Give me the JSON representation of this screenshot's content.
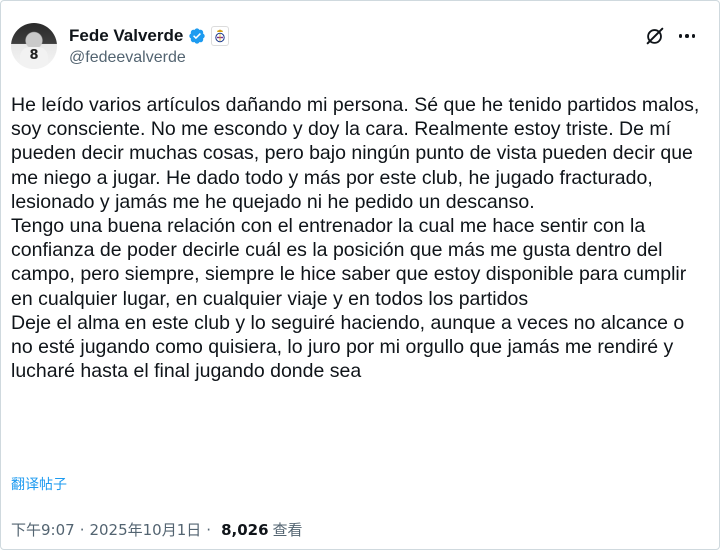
{
  "user": {
    "display_name": "Fede Valverde",
    "handle": "@fedeevalverde",
    "avatar_number": "8"
  },
  "icons": {
    "verified": "verified-badge-icon",
    "affiliate": "real-madrid-crest-icon",
    "grok": "grok-icon",
    "more": "more-icon"
  },
  "colors": {
    "accent": "#1d9bf0",
    "text": "#0f1419",
    "muted": "#536471"
  },
  "tweet": {
    "paragraphs": [
      "He leído varios artículos dañando mi persona. Sé que he tenido partidos malos, soy consciente. No me escondo y doy la cara. Realmente estoy triste. De mí pueden decir muchas cosas, pero bajo ningún punto de vista pueden decir que me niego a jugar. He dado todo y más por este club, he jugado fracturado, lesionado y jamás me he quejado ni he pedido un descanso.",
      "Tengo una buena relación con el entrenador la cual me hace sentir con la confianza de poder decirle cuál es la posición que más me gusta dentro del campo, pero siempre, siempre le hice saber que estoy disponible para cumplir en cualquier lugar, en cualquier viaje y en todos los partidos",
      "Deje el alma en este club y lo seguiré haciendo, aunque a veces no alcance o no esté jugando como quisiera, lo juro por mi orgullo que jamás me rendiré y lucharé hasta el final jugando donde sea"
    ],
    "translate_label": "翻译帖子"
  },
  "meta": {
    "time": "下午9:07",
    "date": "2025年10月1日",
    "separator": "·",
    "views_count": "8,026",
    "views_label": "查看"
  }
}
